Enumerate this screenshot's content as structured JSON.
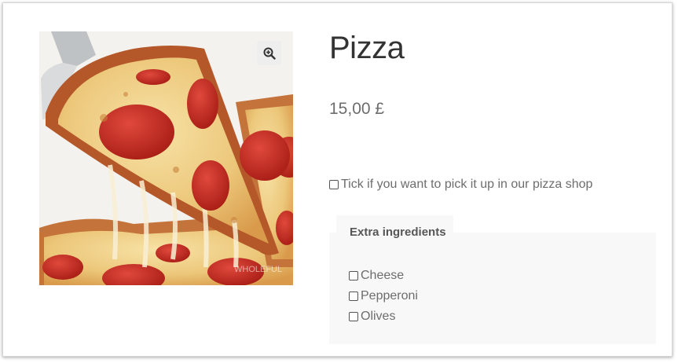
{
  "product": {
    "title": "Pizza",
    "price": "15,00 £",
    "image_alt": "Pizza slice with pepperoni and melted cheese",
    "image_watermark": "WHOLEFUL"
  },
  "zoom": {
    "icon": "zoom-in-icon"
  },
  "pickup": {
    "label": "Tick if you want to pick it up in our pizza shop",
    "checked": false
  },
  "extras": {
    "heading": "Extra ingredients",
    "items": [
      {
        "label": "Cheese",
        "checked": false
      },
      {
        "label": "Pepperoni",
        "checked": false
      },
      {
        "label": "Olives",
        "checked": false
      }
    ]
  },
  "colors": {
    "text": "#6d6d6d",
    "title": "#333333",
    "panel_bg": "#f8f8f8",
    "pepperoni": "#c0271d",
    "cheese": "#f0cf8a",
    "crust": "#b4582a"
  }
}
